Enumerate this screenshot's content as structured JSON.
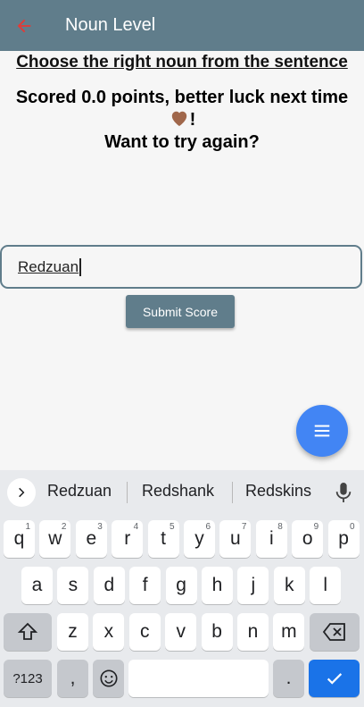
{
  "appbar": {
    "title": "Noun Level"
  },
  "heading": "Choose the right noun from the sentence",
  "result": {
    "line1": "Scored 0.0 points, better luck next time",
    "line2_suffix": "!",
    "line3": "Want to try again?"
  },
  "name_input": {
    "value": "Redzuan"
  },
  "submit_label": "Submit Score",
  "keyboard": {
    "suggestions": [
      "Redzuan",
      "Redshank",
      "Redskins"
    ],
    "row1": [
      [
        "q",
        "1"
      ],
      [
        "w",
        "2"
      ],
      [
        "e",
        "3"
      ],
      [
        "r",
        "4"
      ],
      [
        "t",
        "5"
      ],
      [
        "y",
        "6"
      ],
      [
        "u",
        "7"
      ],
      [
        "i",
        "8"
      ],
      [
        "o",
        "9"
      ],
      [
        "p",
        "0"
      ]
    ],
    "row2": [
      "a",
      "s",
      "d",
      "f",
      "g",
      "h",
      "j",
      "k",
      "l"
    ],
    "row3": [
      "z",
      "x",
      "c",
      "v",
      "b",
      "n",
      "m"
    ],
    "symbols_label": "?123",
    "comma": ",",
    "period": "."
  },
  "colors": {
    "appbar": "#607d8b",
    "fab": "#4285f4",
    "back_arrow": "#e53935",
    "enter": "#1a73e8"
  }
}
